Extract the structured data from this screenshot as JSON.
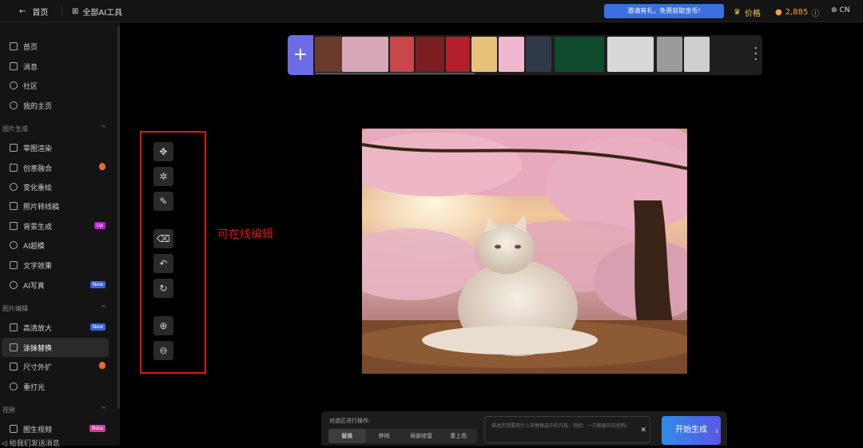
{
  "topbar": {
    "back_label": "首页",
    "tools_label": "全部AI工具",
    "invite_label": "邀请有礼，免费获取金币!",
    "price_label": "价格",
    "coins": "2,885",
    "lang": "CN"
  },
  "sidebar": {
    "nav": [
      {
        "label": "首页",
        "icon": "home-icon"
      },
      {
        "label": "消息",
        "icon": "bell-icon"
      },
      {
        "label": "社区",
        "icon": "compass-icon"
      },
      {
        "label": "我的主页",
        "icon": "user-icon"
      }
    ],
    "group_image_gen": "图片生成",
    "image_gen_items": [
      {
        "label": "草图渲染",
        "icon": "sketch-icon"
      },
      {
        "label": "创意融合",
        "icon": "blend-icon",
        "hot": true
      },
      {
        "label": "变化重绘",
        "icon": "refresh-icon"
      },
      {
        "label": "照片转线稿",
        "icon": "photo-icon"
      },
      {
        "label": "背景生成",
        "icon": "image-icon",
        "badge": "Up"
      },
      {
        "label": "AI超模",
        "icon": "face-icon"
      },
      {
        "label": "文字效果",
        "icon": "text-icon"
      },
      {
        "label": "AI写真",
        "icon": "portrait-icon",
        "badge": "New"
      }
    ],
    "group_image_edit": "图片编辑",
    "image_edit_items": [
      {
        "label": "高清放大",
        "icon": "hd-icon",
        "badge": "New"
      },
      {
        "label": "涂抹替换",
        "icon": "eraser-icon",
        "active": true
      },
      {
        "label": "尺寸外扩",
        "icon": "crop-icon",
        "hot": true
      },
      {
        "label": "重打光",
        "icon": "bulb-icon"
      }
    ],
    "group_video": "视频",
    "video_items": [
      {
        "label": "图生视频",
        "icon": "video-icon",
        "badge": "Beta"
      }
    ],
    "feedback": "给我们发送消息"
  },
  "strip": {
    "thumbs": [
      "#6a3b2c",
      "#d9a8b8",
      "#c9474b",
      "#7b1e22",
      "#b31f2a",
      "#e6c27a",
      "#f1b7d1",
      "#2f3a46",
      "#0f4a2e",
      "#d8d8d8",
      "#9a9a9a",
      "#cfcfcf"
    ]
  },
  "edit_tools": [
    {
      "name": "move-tool-button",
      "icon": "move-icon",
      "glyph": "✥"
    },
    {
      "name": "smart-select-button",
      "icon": "sparkle-select-icon",
      "glyph": "✲"
    },
    {
      "name": "brush-button",
      "icon": "brush-icon",
      "glyph": "✎"
    },
    {
      "name": "eraser-button",
      "icon": "eraser-icon",
      "glyph": "⌫"
    },
    {
      "name": "undo-button",
      "icon": "undo-icon",
      "glyph": "↶"
    },
    {
      "name": "redo-button",
      "icon": "redo-icon",
      "glyph": "↻"
    },
    {
      "name": "zoom-in-button",
      "icon": "zoom-in-icon",
      "glyph": "⊕"
    },
    {
      "name": "zoom-out-button",
      "icon": "zoom-out-icon",
      "glyph": "⊖"
    }
  ],
  "annotation": "可在线编辑",
  "panel": {
    "label": "对选区进行操作:",
    "ops": [
      "替换",
      "移除",
      "局部修复",
      "重上色"
    ],
    "active_op": "替换",
    "placeholder": "描述您想要用什么来替换选中的内容，例如：一只躺着的白色狗。",
    "generate_label": "开始生成",
    "cost": "1"
  },
  "colors": {
    "accent": "#5a56e6",
    "invite": "#3d6fe0",
    "annotation": "#e0141a"
  }
}
